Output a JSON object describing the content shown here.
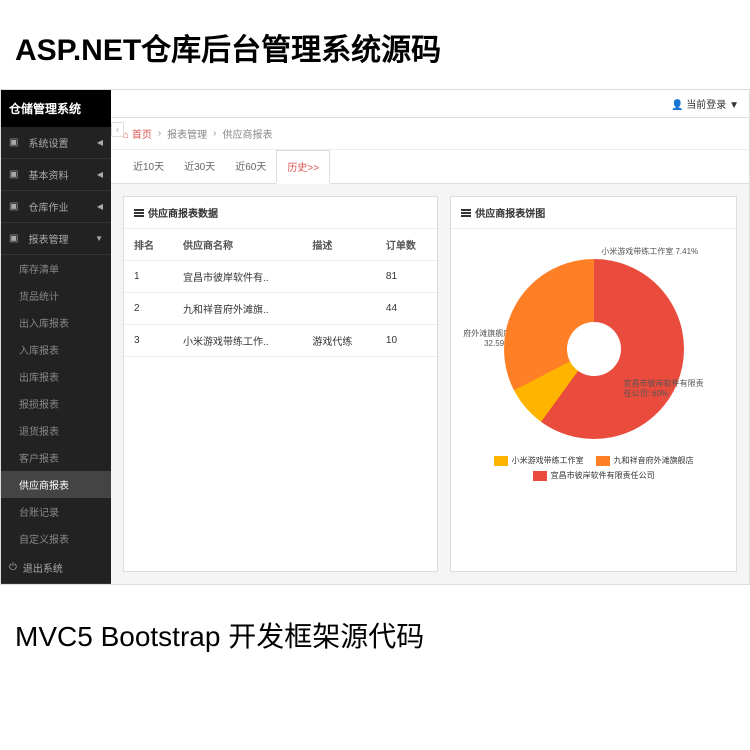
{
  "promo": {
    "top": "ASP.NET仓库后台管理系统源码",
    "bottom": "MVC5 Bootstrap 开发框架源代码"
  },
  "brand": "仓储管理系统",
  "user_label": "当前登录",
  "breadcrumb": {
    "home": "首页",
    "b1": "报表管理",
    "b2": "供应商报表"
  },
  "nav": {
    "sys": "系统设置",
    "base": "基本资料",
    "store": "仓库作业",
    "report": "报表管理",
    "exit": "退出系统",
    "subs": [
      "库存清单",
      "货品统计",
      "出入库报表",
      "入库报表",
      "出库报表",
      "报损报表",
      "退货报表",
      "客户报表",
      "供应商报表",
      "台账记录",
      "自定义报表"
    ]
  },
  "tabs": [
    "近10天",
    "近30天",
    "近60天",
    "历史>>"
  ],
  "table": {
    "title": "供应商报表数据",
    "headers": [
      "排名",
      "供应商名称",
      "描述",
      "订单数"
    ],
    "rows": [
      [
        "1",
        "宜昌市彼岸软件有..",
        "",
        "81"
      ],
      [
        "2",
        "九和祥音府外滩旗..",
        "",
        "44"
      ],
      [
        "3",
        "小米游戏带练工作..",
        "游戏代练",
        "10"
      ]
    ]
  },
  "chart_title": "供应商报表饼图",
  "chart_data": {
    "type": "pie",
    "title": "供应商报表饼图",
    "series": [
      {
        "name": "宜昌市彼岸软件有限责任公司",
        "value": 60,
        "label": "宜昌市彼岸软件有限责任公司: 60%",
        "color": "#e94b3c"
      },
      {
        "name": "小米游戏带练工作室",
        "value": 7.41,
        "label": "小米游戏带练工作室 7.41%",
        "color": "#ffb400"
      },
      {
        "name": "九和祥音府外滩旗舰店",
        "value": 32.59,
        "label": "府外滩旗舰店 32.59%",
        "color": "#ff7f27"
      }
    ],
    "legend": [
      "小米游戏带练工作室",
      "九和祥音府外滩旗舰店",
      "宜昌市彼岸软件有限责任公司"
    ]
  }
}
